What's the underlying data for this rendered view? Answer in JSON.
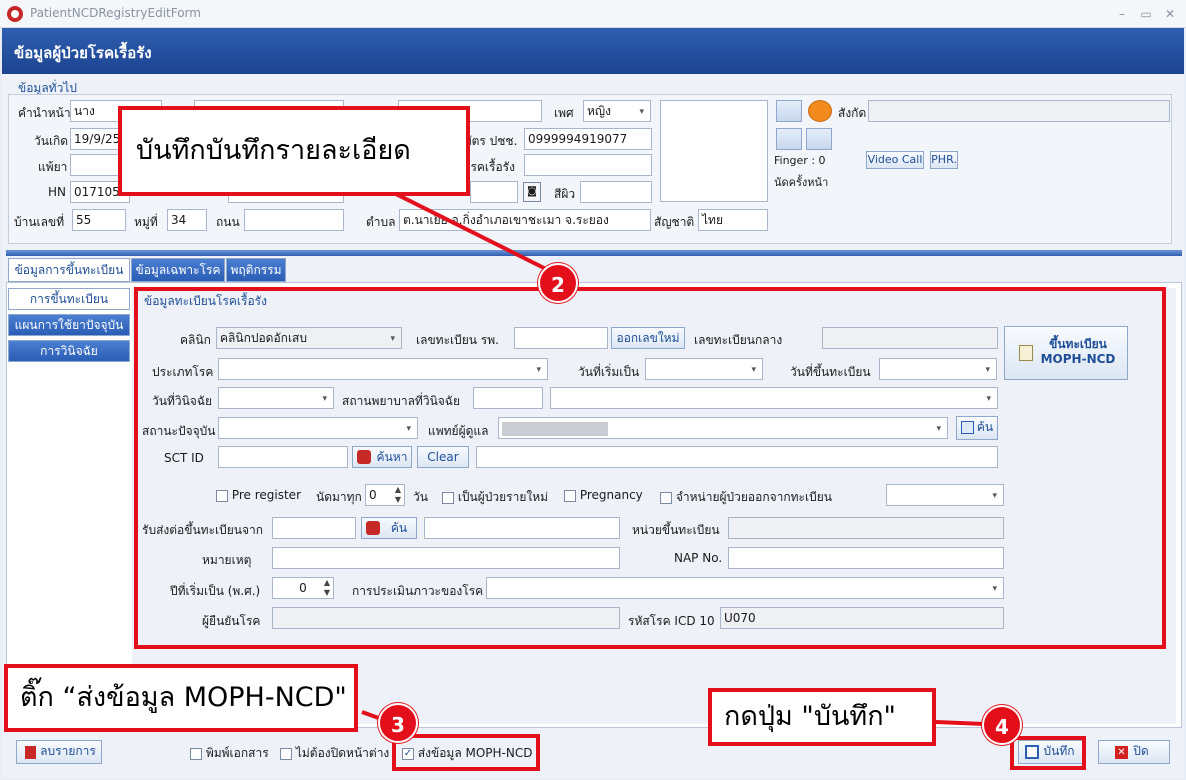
{
  "window": {
    "title": "PatientNCDRegistryEditForm",
    "min": "–",
    "max": "▭",
    "close": "✕"
  },
  "form_title": "ข้อมูลผู้ป่วยโรคเรื้อรัง",
  "general": {
    "group_title": "ข้อมูลทั่วไป",
    "prefix_label": "คำนำหน้า",
    "prefix_value": "นาง",
    "dob_label": "วันเกิด",
    "dob_value": "19/9/25",
    "doctor_label": "แพ้ยา",
    "hn_label": "HN",
    "hn_value": "017105",
    "house_label": "บ้านเลขที่",
    "house_value": "55",
    "moo_label": "หมู่ที่",
    "moo_value": "34",
    "road_label": "ถนน",
    "sex_label": "เพศ",
    "sex_value": "หญิง",
    "cid_label": "บัตร ปชช.",
    "cid_value": "0999994919077",
    "chronic_label": "โรคเรื้อรัง",
    "skin_label": "สีผิว",
    "tambon_label": "ตำบล",
    "tambon_value": "ต.นาเยีย อ.กิ่งอำเภอเขาชะเมา จ.ระยอง",
    "nation_label": "สัญชาติ",
    "nation_value": "ไทย",
    "affil_label": "สังกัด",
    "finger_text": "Finger : 0",
    "appointment_text": "นัดครั้งหน้า",
    "video_call": "Video Call",
    "phr": "PHR."
  },
  "tabs": [
    "ข้อมูลการขึ้นทะเบียน",
    "ข้อมูลเฉพาะโรค",
    "พฤติกรรม"
  ],
  "side_tabs": [
    "การขึ้นทะเบียน",
    "แผนการใช้ยาปัจจุบัน",
    "การวินิจฉัย"
  ],
  "registry": {
    "group_title": "ข้อมูลทะเบียนโรคเรื้อรัง",
    "clinic_label": "คลินิก",
    "clinic_value": "คลินิกปอดอักเสบ",
    "hosp_reg_label": "เลขทะเบียน รพ.",
    "new_number_button": "ออกเลขใหม่",
    "central_reg_label": "เลขทะเบียนกลาง",
    "register_button_line1": "ขึ้นทะเบียน",
    "register_button_line2": "MOPH-NCD",
    "disease_type_label": "ประเภทโรค",
    "start_date_label": "วันที่เริ่มเป็น",
    "reg_date_label": "วันที่ขึ้นทะเบียน",
    "diag_date_label": "วันที่วินิจฉัย",
    "diag_hosp_label": "สถานพยาบาลที่วินิจฉัย",
    "status_label": "สถานะปัจจุบัน",
    "doctor_label": "แพทย์ผู้ดูแล",
    "find_button": "ค้น",
    "sct_label": "SCT ID",
    "search_button": "ค้นหา",
    "clear_button": "Clear",
    "pre_register": "Pre register",
    "appt_every_label": "นัดมาทุก",
    "appt_every_value": "0",
    "day_label": "วัน",
    "new_patient": "เป็นผู้ป่วยรายใหม่",
    "pregnancy": "Pregnancy",
    "discharge": "จำหน่ายผู้ป่วยออกจากทะเบียน",
    "transfer_label": "รับส่งต่อขึ้นทะเบียนจาก",
    "transfer_find": "ค้น",
    "reg_unit_label": "หน่วยขึ้นทะเบียน",
    "note_label": "หมายเหตุ",
    "nap_label": "NAP No.",
    "start_year_label": "ปีที่เริ่มเป็น (พ.ศ.)",
    "start_year_value": "0",
    "assess_label": "การประเมินภาวะของโรค",
    "confirm_label": "ผู้ยืนยันโรค",
    "icd_label": "รหัสโรค ICD 10",
    "icd_value": "U070"
  },
  "footer": {
    "delete_button": "ลบรายการ",
    "print_doc": "พิมพ์เอกสาร",
    "no_close": "ไม่ต้องปิดหน้าต่าง",
    "send_moph": "ส่งข้อมูล MOPH-NCD",
    "save_button": "บันทึก",
    "close_button": "ปิด"
  },
  "annotations": {
    "callout_save_detail": "บันทึกบันทึกรายละเอียด",
    "callout_tick": "ติ๊ก “ส่งข้อมูล MOPH-NCD\"",
    "callout_press": "กดปุ่ม \"บันทึก\"",
    "badge_2": "2",
    "badge_3": "3",
    "badge_4": "4"
  },
  "colors": {
    "accent_red": "#e3101c",
    "header_blue": "#2f5fb0",
    "tab_blue": "#2a5db5"
  }
}
